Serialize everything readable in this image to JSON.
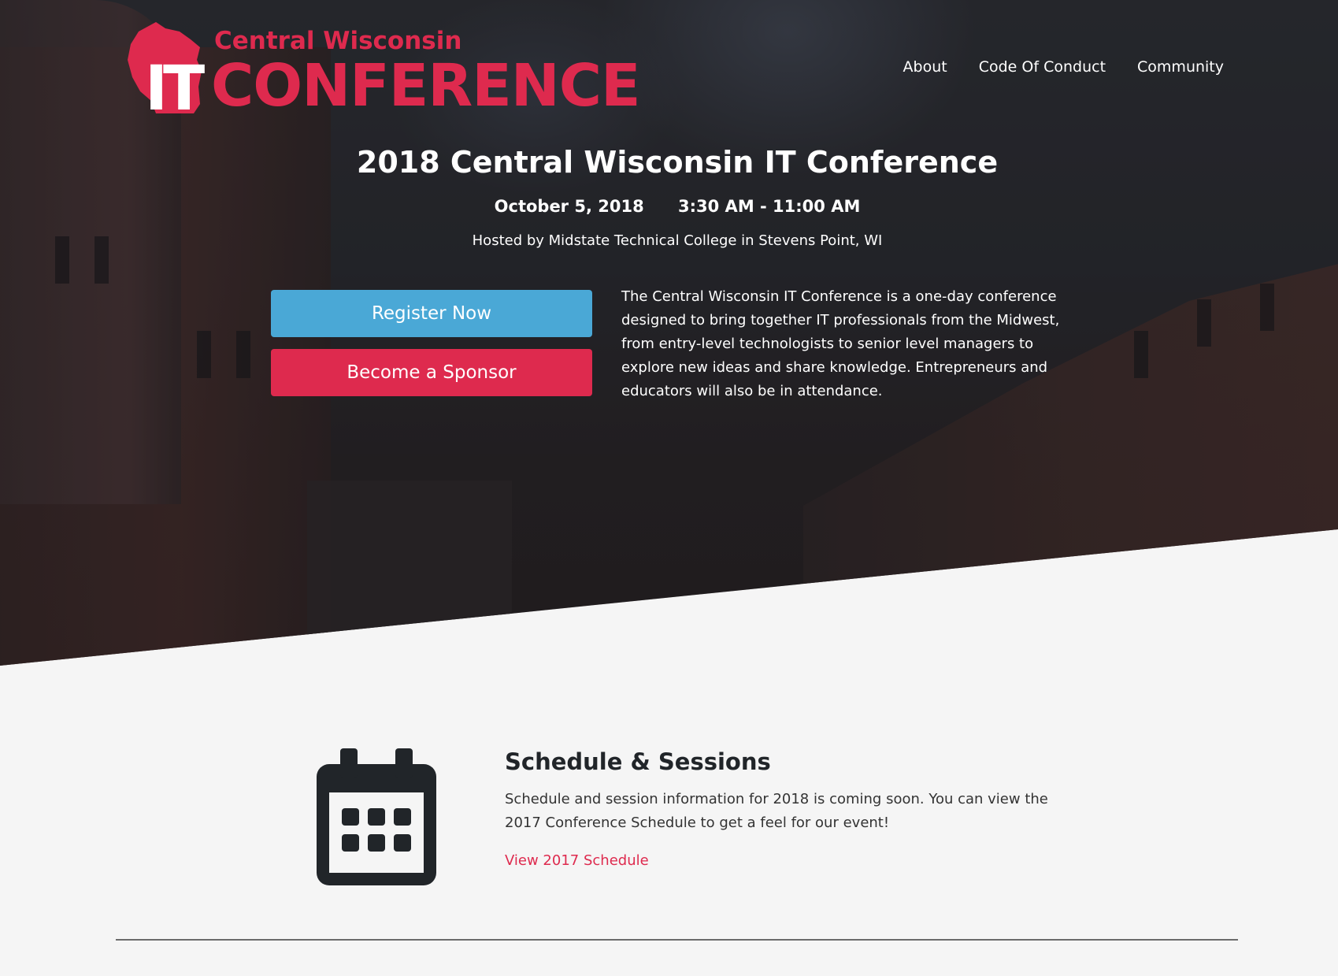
{
  "header": {
    "logo": {
      "top_text": "Central Wisconsin",
      "it_text": "IT",
      "conference_text": "CONFERENCE"
    },
    "nav": [
      {
        "label": "About"
      },
      {
        "label": "Code Of Conduct"
      },
      {
        "label": "Community"
      }
    ]
  },
  "hero": {
    "title": "2018 Central Wisconsin IT Conference",
    "date": "October 5, 2018",
    "time": "3:30 AM - 11:00 AM",
    "hosted": "Hosted by Midstate Technical College in Stevens Point, WI",
    "register_label": "Register Now",
    "sponsor_label": "Become a Sponsor",
    "intro": "The Central Wisconsin IT Conference is a one-day conference designed to bring together IT professionals from the Midwest, from entry-level technologists to senior level managers to explore new ideas and share knowledge. Entrepreneurs and educators will also be in attendance."
  },
  "schedule": {
    "icon": "calendar-icon",
    "title": "Schedule & Sessions",
    "text": "Schedule and session information for 2018 is coming soon. You can view the 2017 Conference Schedule to get a feel for our event!",
    "link_label": "View 2017 Schedule"
  },
  "colors": {
    "brand_red": "#de2a4e",
    "brand_blue": "#4aa8d6",
    "page_bg": "#f5f5f5",
    "hero_dark": "#26272b"
  }
}
